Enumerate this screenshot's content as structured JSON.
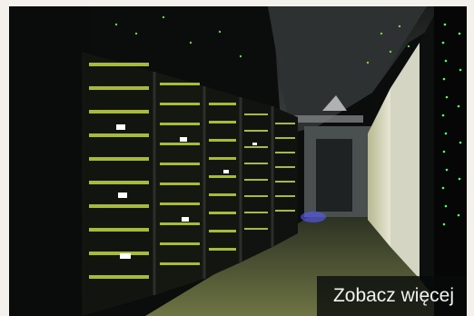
{
  "photo": {
    "icon": "server-room-photo"
  },
  "cta": {
    "label": "Zobacz więcej"
  }
}
